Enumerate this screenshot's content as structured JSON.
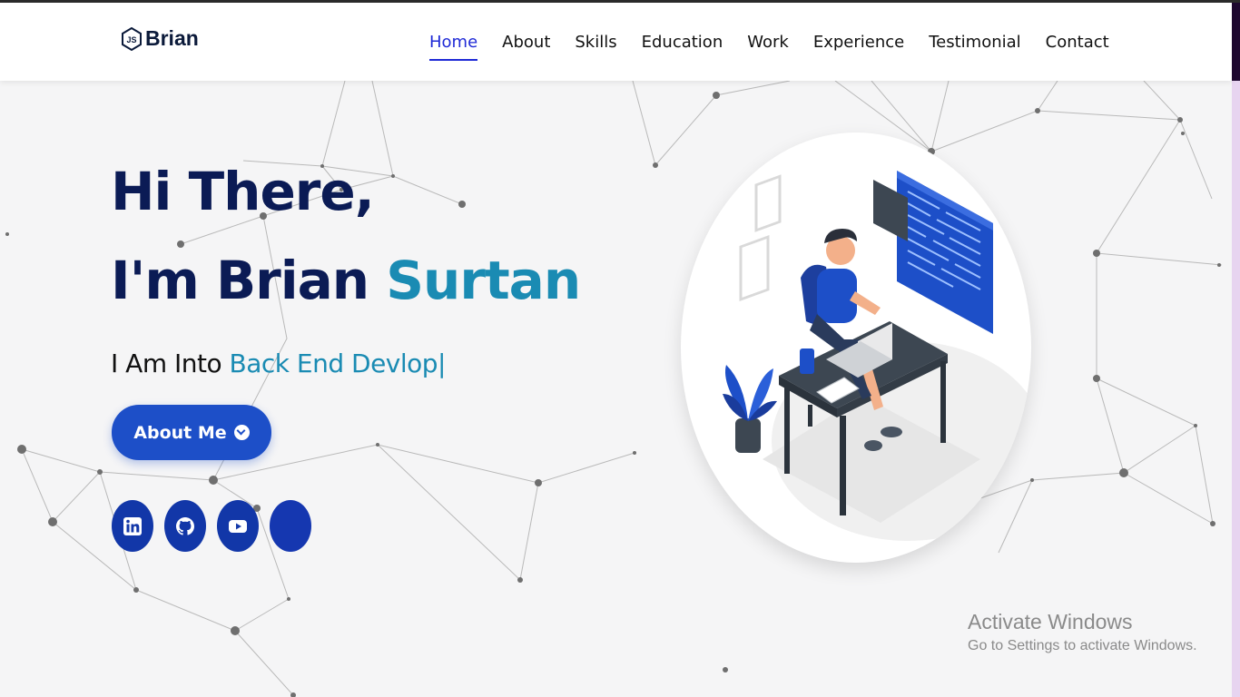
{
  "header": {
    "brand": "Brian",
    "logo_icon": "nodejs-hexagon-icon",
    "nav": [
      {
        "label": "Home",
        "active": true
      },
      {
        "label": "About"
      },
      {
        "label": "Skills"
      },
      {
        "label": "Education"
      },
      {
        "label": "Work"
      },
      {
        "label": "Experience"
      },
      {
        "label": "Testimonial"
      },
      {
        "label": "Contact"
      }
    ]
  },
  "hero": {
    "greeting": "Hi There,",
    "intro": "I'm Brian ",
    "surname": "Surtan",
    "typed_prefix": "I Am Into ",
    "typed_text": "Back End Devlop",
    "cursor": "|",
    "button_label": "About Me",
    "button_icon": "chevron-circle-down-icon"
  },
  "socials": [
    {
      "name": "linkedin-icon"
    },
    {
      "name": "github-icon"
    },
    {
      "name": "youtube-icon"
    },
    {
      "name": "blank-social-icon"
    }
  ],
  "illustration": {
    "name": "developer-at-desk-illustration"
  },
  "watermark": {
    "title": "Activate Windows",
    "subtitle": "Go to Settings to activate Windows."
  },
  "colors": {
    "navy": "#0b1b55",
    "accent_teal": "#1a8bb3",
    "button_blue": "#1d4fc8",
    "nav_active": "#1f2ad6",
    "social_bg": "#1237a8"
  }
}
